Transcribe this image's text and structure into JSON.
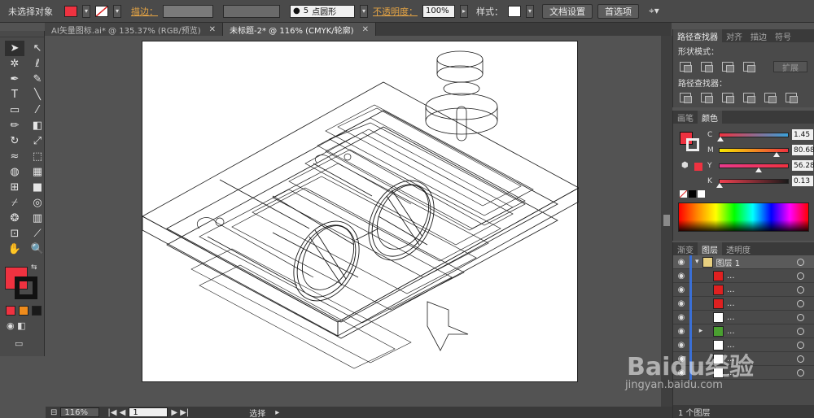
{
  "control_bar": {
    "selection_label": "未选择对象",
    "fill_color": "#ef3240",
    "stroke_label": "描边：",
    "brush_size": "5",
    "brush_shape": "点圆形",
    "opacity_label": "不透明度：",
    "opacity_value": "100%",
    "style_label": "样式：",
    "doc_setup_button": "文档设置",
    "preferences_button": "首选项"
  },
  "tabs": [
    {
      "label": "AI矢量图标.ai* @ 135.37% (RGB/预览)",
      "active": false
    },
    {
      "label": "未标题-2* @ 116% (CMYK/轮廓)",
      "active": true
    }
  ],
  "tools": [
    {
      "name": "selection-tool",
      "glyph": "➤"
    },
    {
      "name": "direct-selection-tool",
      "glyph": "↖"
    },
    {
      "name": "magic-wand-tool",
      "glyph": "✲"
    },
    {
      "name": "lasso-tool",
      "glyph": "ℓ"
    },
    {
      "name": "pen-tool",
      "glyph": "✒"
    },
    {
      "name": "curvature-tool",
      "glyph": "✎"
    },
    {
      "name": "type-tool",
      "glyph": "T"
    },
    {
      "name": "line-tool",
      "glyph": "╲"
    },
    {
      "name": "rectangle-tool",
      "glyph": "▭"
    },
    {
      "name": "paintbrush-tool",
      "glyph": "⁄"
    },
    {
      "name": "pencil-tool",
      "glyph": "✏"
    },
    {
      "name": "eraser-tool",
      "glyph": "◧"
    },
    {
      "name": "rotate-tool",
      "glyph": "↻"
    },
    {
      "name": "scale-tool",
      "glyph": "⤢"
    },
    {
      "name": "width-tool",
      "glyph": "≈"
    },
    {
      "name": "free-transform-tool",
      "glyph": "⬚"
    },
    {
      "name": "shape-builder-tool",
      "glyph": "◍"
    },
    {
      "name": "perspective-grid-tool",
      "glyph": "▦"
    },
    {
      "name": "mesh-tool",
      "glyph": "⊞"
    },
    {
      "name": "gradient-tool",
      "glyph": "■"
    },
    {
      "name": "eyedropper-tool",
      "glyph": "⌿"
    },
    {
      "name": "blend-tool",
      "glyph": "◎"
    },
    {
      "name": "symbol-sprayer-tool",
      "glyph": "❂"
    },
    {
      "name": "column-graph-tool",
      "glyph": "▥"
    },
    {
      "name": "artboard-tool",
      "glyph": "⊡"
    },
    {
      "name": "slice-tool",
      "glyph": "⟋"
    },
    {
      "name": "hand-tool",
      "glyph": "✋"
    },
    {
      "name": "zoom-tool",
      "glyph": "🔍"
    }
  ],
  "colors": {
    "fill": "#ef3240",
    "stroke": "#111111",
    "mini_swatches": [
      "#ef3240",
      "#f08c1c",
      "#1a1a1a"
    ]
  },
  "status_bar": {
    "zoom": "116%",
    "page": "1",
    "mode": "选择"
  },
  "pathfinder_panel": {
    "tabs": [
      "路径查找器",
      "对齐",
      "描边",
      "符号"
    ],
    "shape_modes_label": "形状模式：",
    "expand_button": "扩展",
    "pathfinders_label": "路径查找器："
  },
  "color_panel": {
    "tabs": [
      "画笔",
      "颜色"
    ],
    "channels": [
      {
        "label": "C",
        "value": "1.45",
        "fraction": 0.015,
        "gradient": "linear-gradient(to right,#ef3240,#3aa0d8)"
      },
      {
        "label": "M",
        "value": "80.68",
        "fraction": 0.81,
        "gradient": "linear-gradient(to right,#f5e600,#ef3240)"
      },
      {
        "label": "Y",
        "value": "56.28",
        "fraction": 0.56,
        "gradient": "linear-gradient(to right,#e83a8c,#ef3240)"
      },
      {
        "label": "K",
        "value": "0.13",
        "fraction": 0.0,
        "gradient": "linear-gradient(to right,#f04050,#1a1a1a)"
      }
    ]
  },
  "layers_panel": {
    "tabs": [
      "渐变",
      "图层",
      "透明度"
    ],
    "top_layer": "图层 1",
    "sublayers": [
      "...",
      "...",
      "...",
      "...",
      "...",
      "...",
      "...",
      "..."
    ],
    "count_label": "1 个图层"
  },
  "watermark": {
    "brand": "Baidu经验",
    "url": "jingyan.baidu.com"
  }
}
